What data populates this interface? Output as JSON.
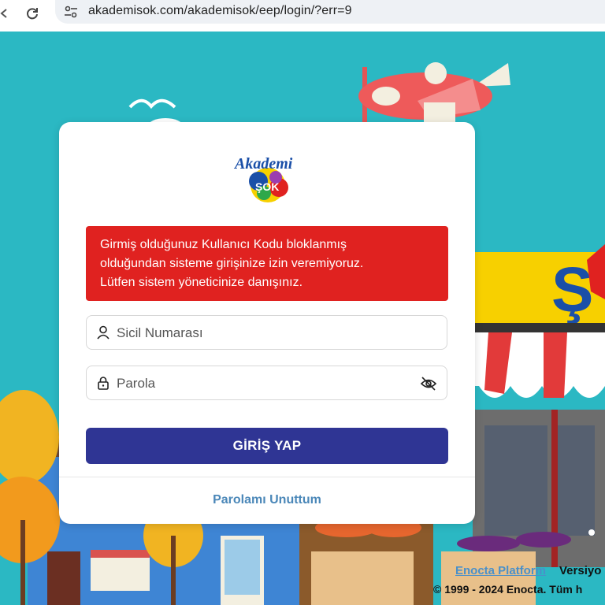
{
  "browser": {
    "url": "akademisok.com/akademisok/eep/login/?err=9"
  },
  "login": {
    "logo_text_top": "Akademi",
    "logo_text_bottom": "ŞOK",
    "alert_lines": [
      "Girmiş olduğunuz Kullanıcı Kodu bloklanmış",
      "olduğundan sisteme girişinize izin veremiyoruz.",
      "Lütfen sistem yöneticinize danışınız."
    ],
    "username_placeholder": "Sicil Numarası",
    "password_placeholder": "Parola",
    "submit_label": "GİRİŞ YAP",
    "forgot_label": "Parolamı Unuttum"
  },
  "footer": {
    "platform_link": "Enocta Platform",
    "version_label": "Versiyo",
    "copyright": "© 1999 - 2024 Enocta. Tüm h"
  },
  "colors": {
    "background_teal": "#2bb8c3",
    "alert_red": "#e02220",
    "button_navy": "#2f3594",
    "link_blue": "#4a87b8"
  },
  "icons": [
    "back-icon",
    "reload-icon",
    "site-info-icon",
    "user-icon",
    "lock-icon",
    "eye-slash-icon"
  ]
}
